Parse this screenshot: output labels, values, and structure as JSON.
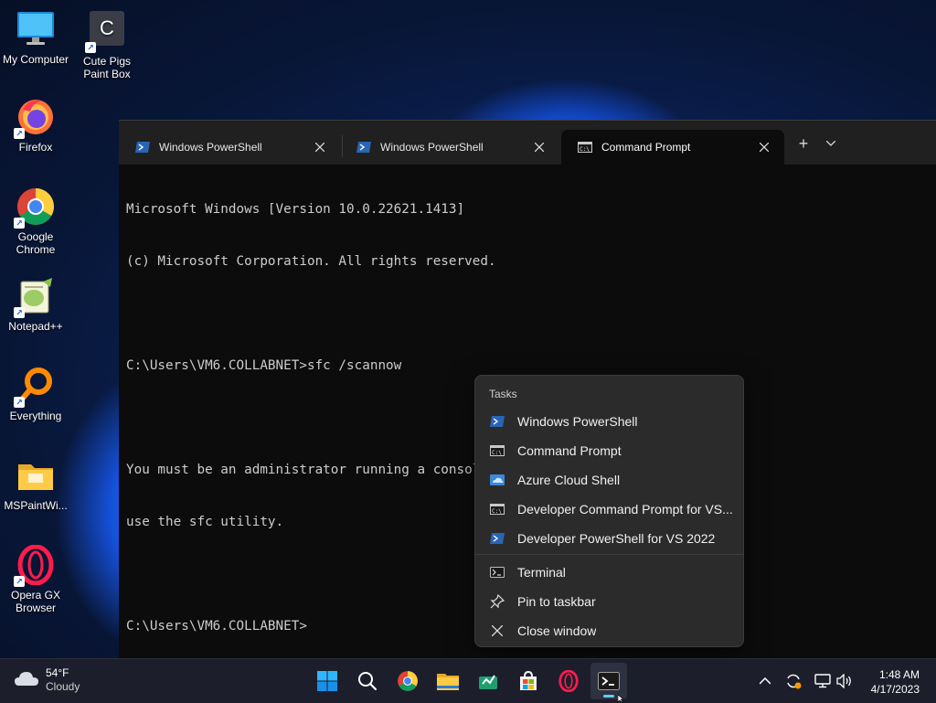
{
  "desktop": {
    "icons": [
      {
        "label": "My Computer",
        "icon": "monitor-icon"
      },
      {
        "label": "Cute Pigs Paint Box",
        "icon": "letter-c-icon",
        "glyph_text": "C"
      },
      {
        "label": "Firefox",
        "icon": "firefox-icon"
      },
      {
        "label": "Google Chrome",
        "icon": "chrome-icon"
      },
      {
        "label": "Notepad++",
        "icon": "notepadpp-icon"
      },
      {
        "label": "Everything",
        "icon": "magnifier-icon"
      },
      {
        "label": "MSPaintWi...",
        "icon": "folder-icon"
      },
      {
        "label": "Opera GX Browser",
        "icon": "opera-gx-icon"
      }
    ]
  },
  "terminal": {
    "tabs": [
      {
        "title": "Windows PowerShell",
        "icon": "powershell-icon",
        "active": false
      },
      {
        "title": "Windows PowerShell",
        "icon": "powershell-icon",
        "active": false
      },
      {
        "title": "Command Prompt",
        "icon": "cmd-icon",
        "active": true
      }
    ],
    "new_tab_symbol": "+",
    "console_lines": [
      "Microsoft Windows [Version 10.0.22621.1413]",
      "(c) Microsoft Corporation. All rights reserved.",
      "",
      "C:\\Users\\VM6.COLLABNET>sfc /scannow",
      "",
      "You must be an administrator running a console session in order to",
      "use the sfc utility.",
      "",
      "C:\\Users\\VM6.COLLABNET>"
    ]
  },
  "jumplist": {
    "header": "Tasks",
    "tasks": [
      {
        "label": "Windows PowerShell",
        "icon": "powershell-icon"
      },
      {
        "label": "Command Prompt",
        "icon": "cmd-icon"
      },
      {
        "label": "Azure Cloud Shell",
        "icon": "azure-cloud-shell-icon"
      },
      {
        "label": "Developer Command Prompt for VS...",
        "icon": "cmd-icon"
      },
      {
        "label": "Developer PowerShell for VS 2022",
        "icon": "powershell-icon"
      }
    ],
    "actions": [
      {
        "label": "Terminal",
        "icon": "terminal-icon"
      },
      {
        "label": "Pin to taskbar",
        "icon": "pin-icon"
      },
      {
        "label": "Close window",
        "icon": "close-icon"
      }
    ]
  },
  "taskbar": {
    "weather": {
      "temperature": "54°F",
      "condition": "Cloudy"
    },
    "apps": [
      "start-icon",
      "search-icon",
      "chrome-icon",
      "file-explorer-icon",
      "green-app-icon",
      "microsoft-store-icon",
      "opera-gx-icon",
      "terminal-icon"
    ],
    "clock": {
      "time": "1:48 AM",
      "date": "4/17/2023"
    }
  },
  "colors": {
    "terminal_background": "#0c0c0c",
    "tabbar_background": "#202020",
    "menu_background": "#2b2b2b",
    "taskbar_background": "#1c1f2b",
    "accent": "#60cdff"
  }
}
